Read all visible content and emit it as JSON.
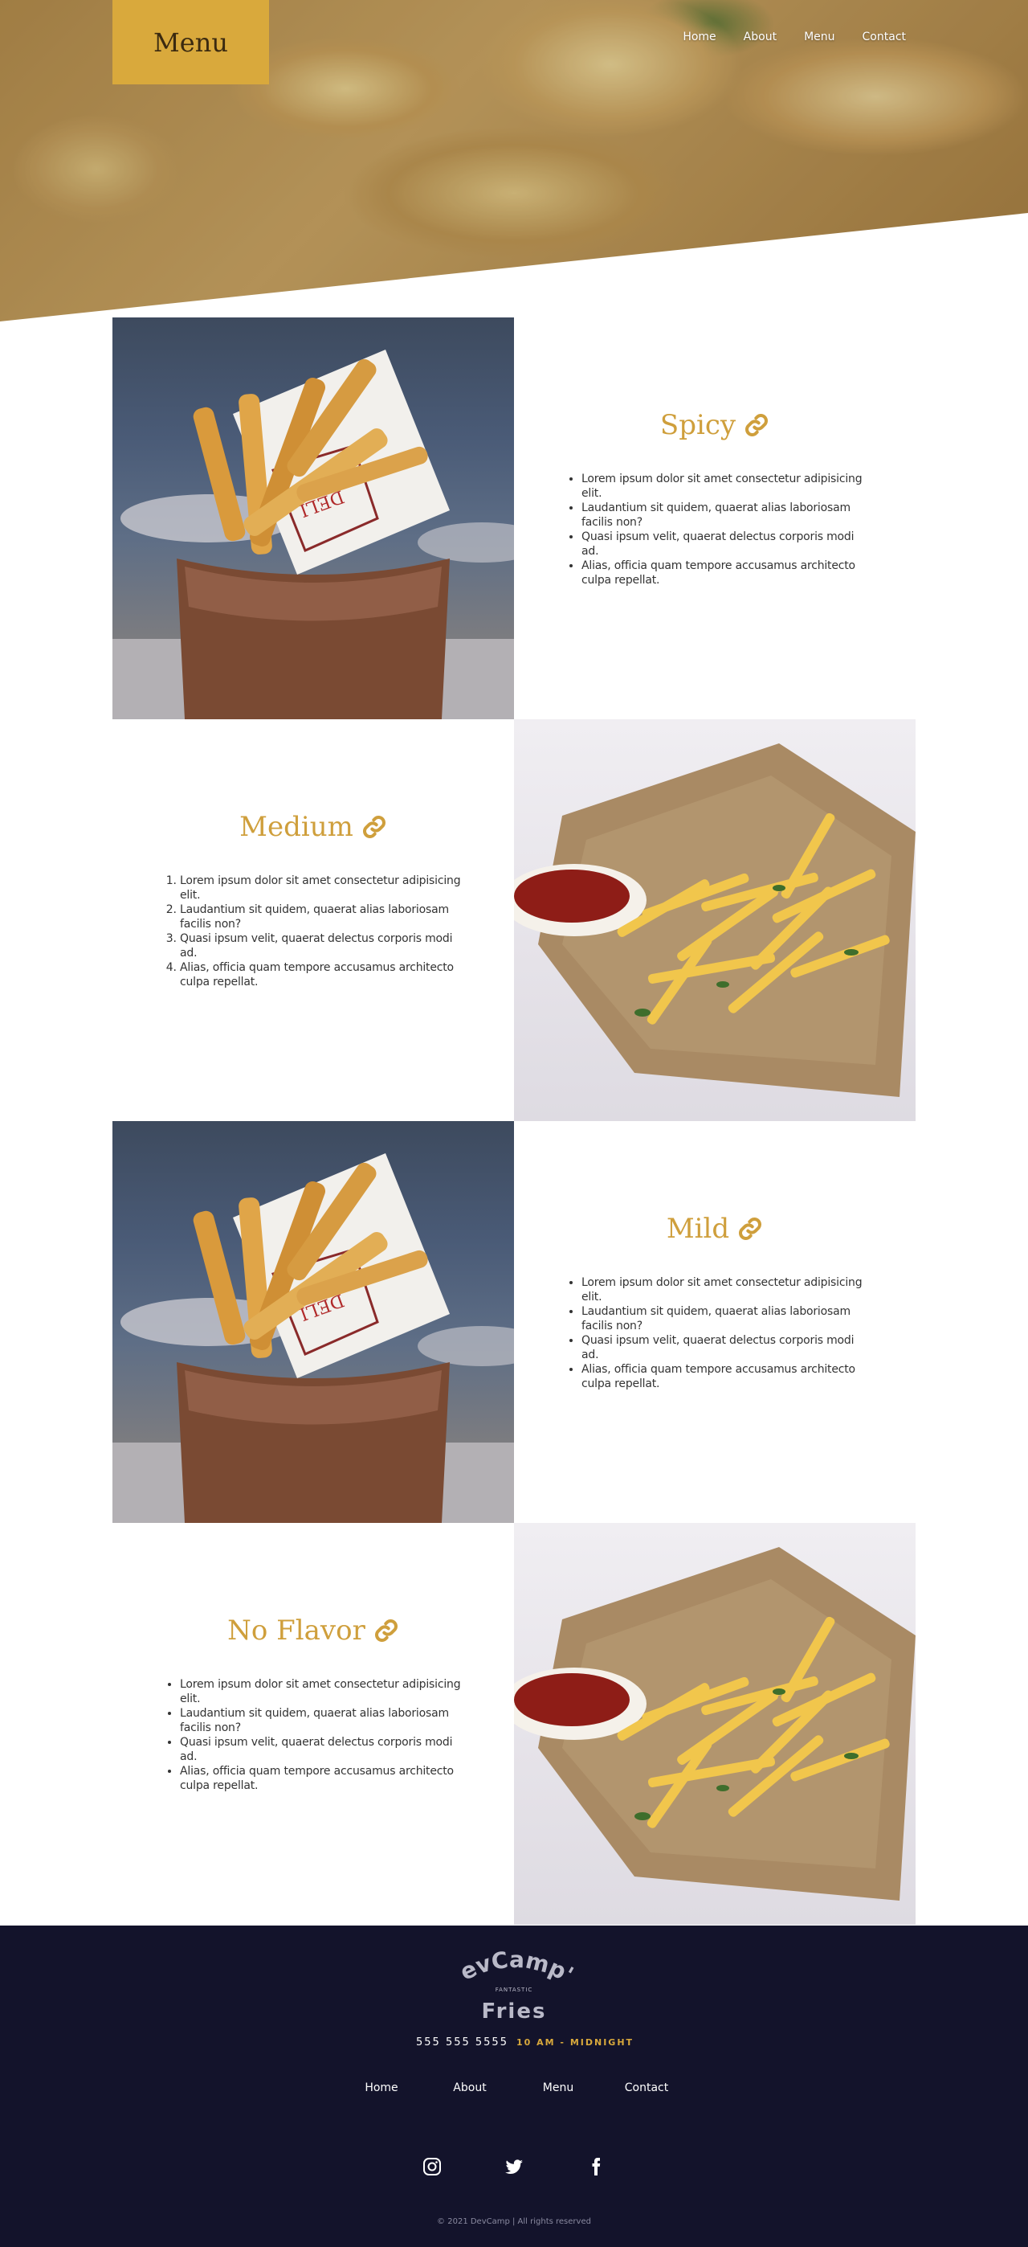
{
  "header": {
    "brand_label": "Menu",
    "nav": [
      "Home",
      "About",
      "Menu",
      "Contact"
    ]
  },
  "sections": [
    {
      "title": "Spicy",
      "list_type": "unordered",
      "items": [
        "Lorem ipsum dolor sit amet consectetur adipisicing elit.",
        "Laudantium sit quidem, quaerat alias laboriosam facilis non?",
        "Quasi ipsum velit, quaerat delectus corporis modi ad.",
        "Alias, officia quam tempore accusamus architecto culpa repellat."
      ]
    },
    {
      "title": "Medium",
      "list_type": "ordered",
      "items": [
        "Lorem ipsum dolor sit amet consectetur adipisicing elit.",
        "Laudantium sit quidem, quaerat alias laboriosam facilis non?",
        "Quasi ipsum velit, quaerat delectus corporis modi ad.",
        "Alias, officia quam tempore accusamus architecto culpa repellat."
      ]
    },
    {
      "title": "Mild",
      "list_type": "unordered",
      "items": [
        "Lorem ipsum dolor sit amet consectetur adipisicing elit.",
        "Laudantium sit quidem, quaerat alias laboriosam facilis non?",
        "Quasi ipsum velit, quaerat delectus corporis modi ad.",
        "Alias, officia quam tempore accusamus architecto culpa repellat."
      ]
    },
    {
      "title": "No Flavor",
      "list_type": "unordered",
      "items": [
        "Lorem ipsum dolor sit amet consectetur adipisicing elit.",
        "Laudantium sit quidem, quaerat alias laboriosam facilis non?",
        "Quasi ipsum velit, quaerat delectus corporis modi ad.",
        "Alias, officia quam tempore accusamus architecto culpa repellat."
      ]
    }
  ],
  "footer": {
    "logo": {
      "line1": "DevCamp's",
      "line2": "FANTASTIC",
      "line3": "Fries"
    },
    "phone": "555 555 5555",
    "hours": "10 AM - MIDNIGHT",
    "nav": [
      "Home",
      "About",
      "Menu",
      "Contact"
    ],
    "socials": [
      "instagram-icon",
      "twitter-icon",
      "facebook-icon"
    ],
    "copyright": "© 2021 DevCamp | All rights reserved"
  },
  "colors": {
    "accent": "#d9a93c",
    "heading": "#cf9f3c",
    "footer_bg": "#13132b"
  }
}
